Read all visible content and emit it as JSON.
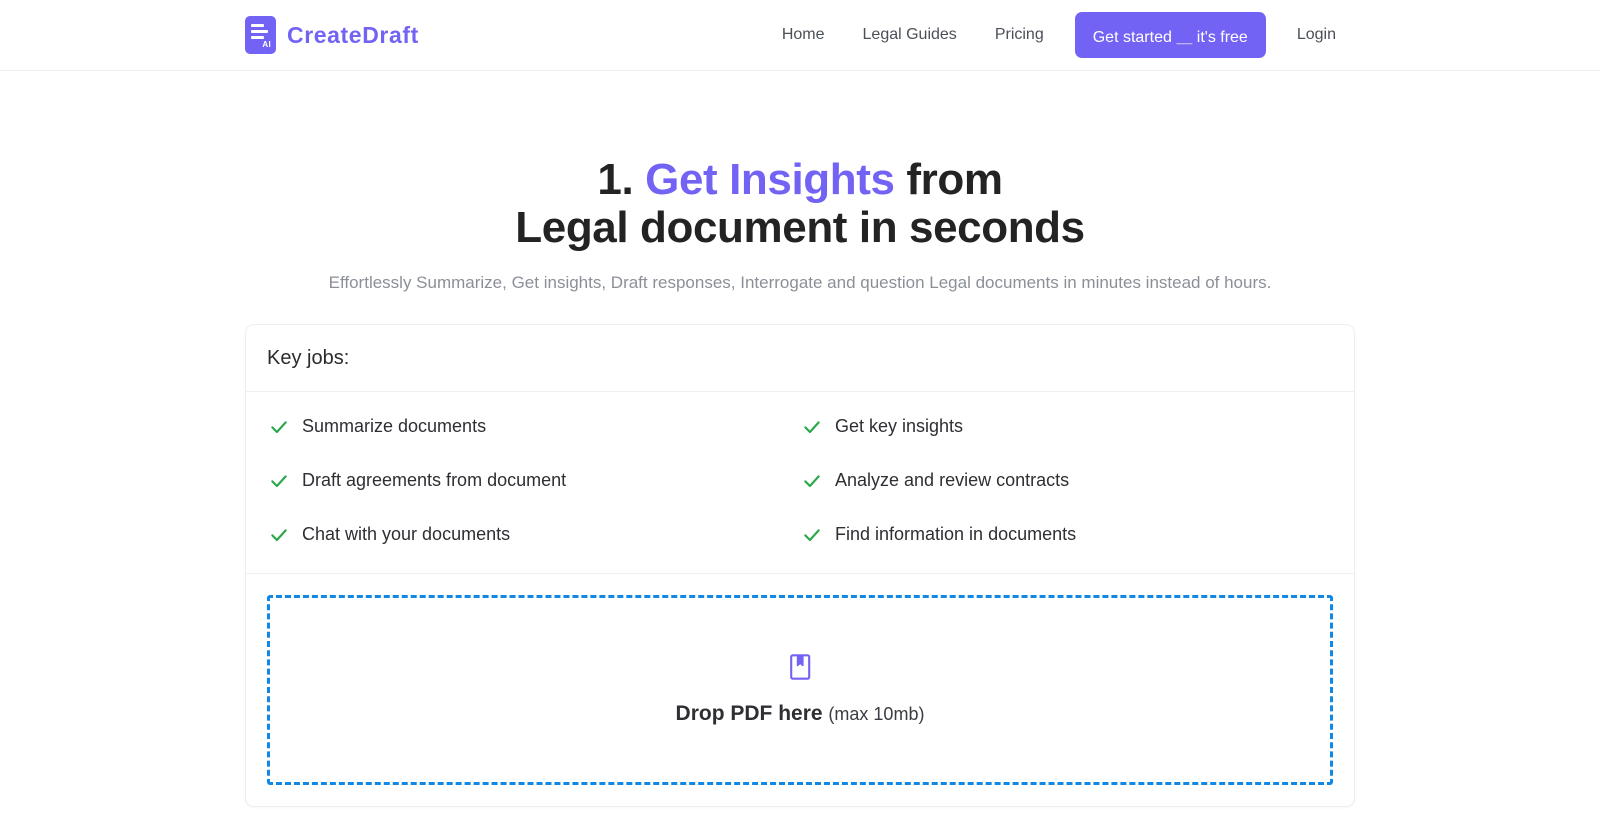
{
  "brand": {
    "name": "CreateDraft",
    "mark_badge": "AI",
    "accent_color": "#7363f5"
  },
  "nav": {
    "links": [
      {
        "label": "Home",
        "name": "home"
      },
      {
        "label": "Legal Guides",
        "name": "legal-guides"
      },
      {
        "label": "Pricing",
        "name": "pricing"
      }
    ],
    "cta_label": "Get started ＿ it's free",
    "login_label": "Login"
  },
  "hero": {
    "headline_number": "1. ",
    "headline_accent": "Get Insights",
    "headline_rest": " from",
    "headline_line2": "Legal document in seconds",
    "subhead": "Effortlessly Summarize, Get insights, Draft responses, Interrogate and question Legal documents in minutes instead of hours."
  },
  "card": {
    "title": "Key jobs:",
    "jobs": [
      {
        "label": "Summarize documents"
      },
      {
        "label": "Get key insights"
      },
      {
        "label": "Draft agreements from document"
      },
      {
        "label": "Analyze and review contracts"
      },
      {
        "label": "Chat with your documents"
      },
      {
        "label": "Find information in documents"
      }
    ],
    "check_color": "#2ba84a"
  },
  "dropzone": {
    "icon": "book-icon",
    "main_text": "Drop PDF here",
    "sub_text": "(max 10mb)",
    "border_color": "#1288e6"
  }
}
